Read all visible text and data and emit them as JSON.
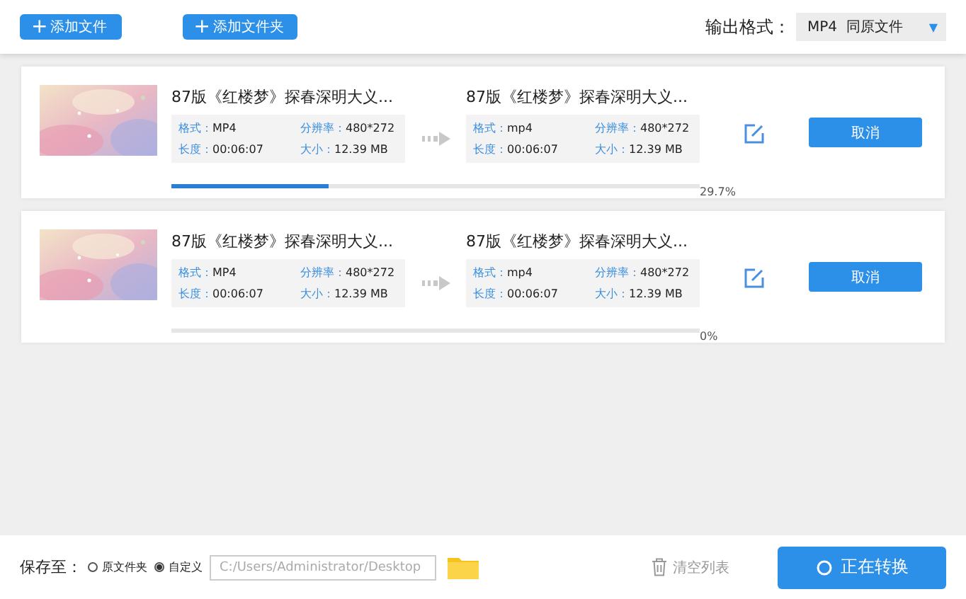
{
  "toolbar": {
    "buttons": [
      {
        "icon": "+",
        "label": "添加文件"
      },
      {
        "icon": "+",
        "label": "添加文件夹"
      }
    ],
    "output_format": {
      "label": "输出格式：",
      "value": "MP4  同原文件",
      "caret": "▼"
    }
  },
  "tasks": [
    {
      "source": {
        "title": "87版《红楼梦》探春深明大义...",
        "format_label": "格式：",
        "format": "MP4",
        "resolution_label": "分辨率：",
        "resolution": "480*272",
        "duration_label": "长度：",
        "duration": "00:06:07",
        "size_label": "大小：",
        "size": "12.39 MB"
      },
      "target": {
        "title": "87版《红楼梦》探春深明大义...",
        "format_label": "格式：",
        "format": "mp4",
        "resolution_label": "分辨率：",
        "resolution": "480*272",
        "duration_label": "长度：",
        "duration": "00:06:07",
        "size_label": "大小：",
        "size": "12.39 MB"
      },
      "cancel": "取消",
      "level": 0.297,
      "percent": "29.7%"
    },
    {
      "source": {
        "title": "87版《红楼梦》探春深明大义...",
        "format_label": "格式：",
        "format": "MP4",
        "resolution_label": "分辨率：",
        "resolution": "480*272",
        "duration_label": "长度：",
        "duration": "00:06:07",
        "size_label": "大小：",
        "size": "12.39 MB"
      },
      "target": {
        "title": "87版《红楼梦》探春深明大义...",
        "format_label": "格式：",
        "format": "mp4",
        "resolution_label": "分辨率：",
        "resolution": "480*272",
        "duration_label": "长度：",
        "duration": "00:06:07",
        "size_label": "大小：",
        "size": "12.39 MB"
      },
      "cancel": "取消",
      "level": 0,
      "percent": "0%"
    }
  ],
  "footer": {
    "save_label": "保存至：",
    "options": [
      {
        "label": "原文件夹",
        "selected": false
      },
      {
        "label": "自定义",
        "selected": true
      }
    ],
    "path": "C:/Users/Administrator/Desktop",
    "clear": "清空列表",
    "convert": "正在转换"
  }
}
